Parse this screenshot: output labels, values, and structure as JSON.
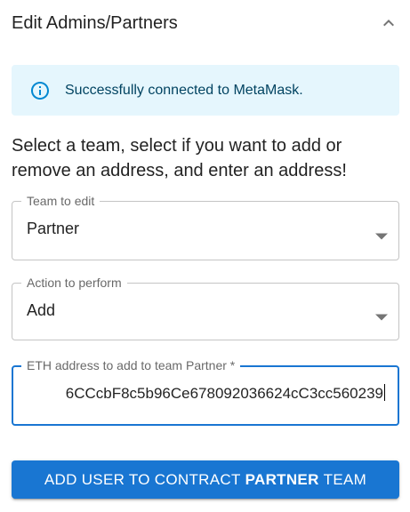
{
  "panel": {
    "title": "Edit Admins/Partners",
    "collapse_icon": "chevron-up-icon"
  },
  "alert": {
    "icon": "info-icon",
    "message": "Successfully connected to MetaMask.",
    "colors": {
      "background": "#e5f6fd",
      "text": "#014361",
      "icon": "#0288d1"
    }
  },
  "instructions": "Select a team, select if you want to add or remove an address, and enter an address!",
  "team_field": {
    "label": "Team to edit",
    "value": "Partner"
  },
  "action_field": {
    "label": "Action to perform",
    "value": "Add"
  },
  "address_field": {
    "label": "ETH address to add to team Partner",
    "required_mark": "*",
    "value": "6CCcbF8c5b96Ce678092036624cC3cc560239"
  },
  "submit_button": {
    "prefix": "ADD USER TO CONTRACT",
    "team": "PARTNER",
    "suffix": "TEAM"
  },
  "colors": {
    "primary": "#1976d2"
  }
}
